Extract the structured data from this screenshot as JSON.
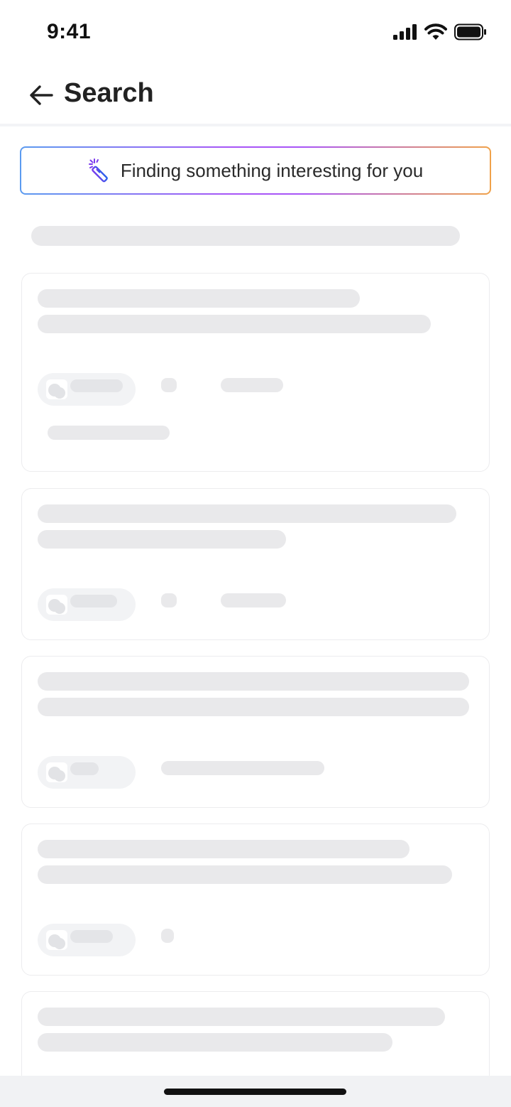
{
  "status_bar": {
    "time": "9:41",
    "icons": [
      "signal-icon",
      "wifi-icon",
      "battery-icon"
    ]
  },
  "header": {
    "back_icon": "arrow-left-icon",
    "title": "Search"
  },
  "ai_banner": {
    "icon": "magic-wand-icon",
    "text": "Finding something interesting for you",
    "gradient_colors": [
      "#5b9bf0",
      "#a855f7",
      "#f0a24a"
    ]
  },
  "state": "loading",
  "colors": {
    "skeleton": "#e9e9eb",
    "card_border": "#ececee",
    "pill_bg": "#f2f3f5"
  }
}
